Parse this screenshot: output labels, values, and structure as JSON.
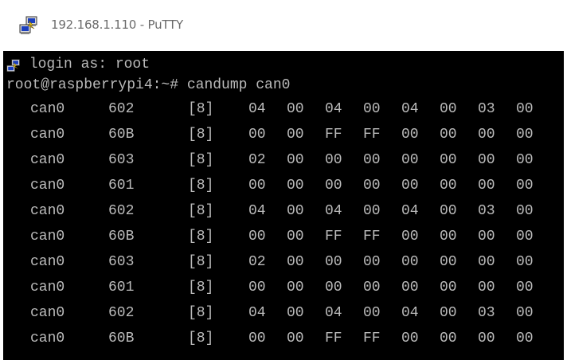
{
  "window": {
    "title": "192.168.1.110 - PuTTY"
  },
  "terminal": {
    "login_line": " login as: root",
    "prompt_line": "root@raspberrypi4:~# candump can0",
    "frames": [
      {
        "iface": "can0",
        "id": "602",
        "dlc": "[8]",
        "bytes": [
          "04",
          "00",
          "04",
          "00",
          "04",
          "00",
          "03",
          "00"
        ]
      },
      {
        "iface": "can0",
        "id": "60B",
        "dlc": "[8]",
        "bytes": [
          "00",
          "00",
          "FF",
          "FF",
          "00",
          "00",
          "00",
          "00"
        ]
      },
      {
        "iface": "can0",
        "id": "603",
        "dlc": "[8]",
        "bytes": [
          "02",
          "00",
          "00",
          "00",
          "00",
          "00",
          "00",
          "00"
        ]
      },
      {
        "iface": "can0",
        "id": "601",
        "dlc": "[8]",
        "bytes": [
          "00",
          "00",
          "00",
          "00",
          "00",
          "00",
          "00",
          "00"
        ]
      },
      {
        "iface": "can0",
        "id": "602",
        "dlc": "[8]",
        "bytes": [
          "04",
          "00",
          "04",
          "00",
          "04",
          "00",
          "03",
          "00"
        ]
      },
      {
        "iface": "can0",
        "id": "60B",
        "dlc": "[8]",
        "bytes": [
          "00",
          "00",
          "FF",
          "FF",
          "00",
          "00",
          "00",
          "00"
        ]
      },
      {
        "iface": "can0",
        "id": "603",
        "dlc": "[8]",
        "bytes": [
          "02",
          "00",
          "00",
          "00",
          "00",
          "00",
          "00",
          "00"
        ]
      },
      {
        "iface": "can0",
        "id": "601",
        "dlc": "[8]",
        "bytes": [
          "00",
          "00",
          "00",
          "00",
          "00",
          "00",
          "00",
          "00"
        ]
      },
      {
        "iface": "can0",
        "id": "602",
        "dlc": "[8]",
        "bytes": [
          "04",
          "00",
          "04",
          "00",
          "04",
          "00",
          "03",
          "00"
        ]
      },
      {
        "iface": "can0",
        "id": "60B",
        "dlc": "[8]",
        "bytes": [
          "00",
          "00",
          "FF",
          "FF",
          "00",
          "00",
          "00",
          "00"
        ]
      }
    ]
  },
  "colors": {
    "terminal_bg": "#000000",
    "terminal_fg": "#bbbbbb",
    "titlebar_bg": "#ffffff",
    "title_fg": "#6b6b6b"
  },
  "icons": {
    "app": "putty-icon",
    "login": "putty-icon"
  }
}
